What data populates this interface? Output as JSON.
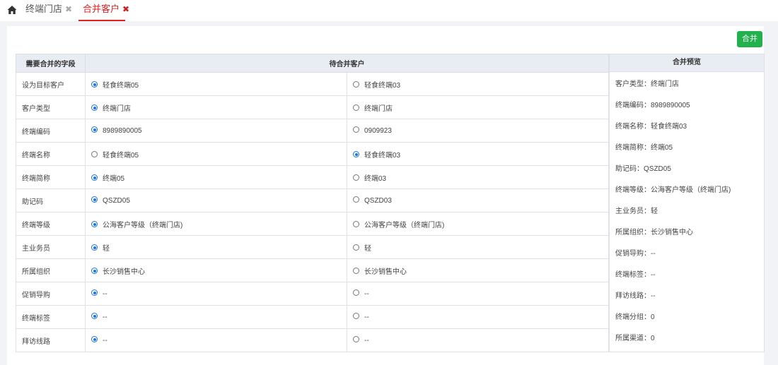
{
  "tabs": [
    {
      "label": "终端门店",
      "close": "✖"
    },
    {
      "label": "合并客户",
      "close": "✖"
    }
  ],
  "toolbar": {
    "merge_label": "合并"
  },
  "table": {
    "headers": [
      "需要合并的字段",
      "待合并客户"
    ],
    "rows": [
      {
        "field": "设为目标客户",
        "a": "轻食终端05",
        "b": "轻食终端03",
        "selected": "a"
      },
      {
        "field": "客户类型",
        "a": "终端门店",
        "b": "终端门店",
        "selected": "a"
      },
      {
        "field": "终端编码",
        "a": "8989890005",
        "b": "0909923",
        "selected": "a"
      },
      {
        "field": "终端名称",
        "a": "轻食终端05",
        "b": "轻食终端03",
        "selected": "b"
      },
      {
        "field": "终端简称",
        "a": "终端05",
        "b": "终端03",
        "selected": "a"
      },
      {
        "field": "助记码",
        "a": "QSZD05",
        "b": "QSZD03",
        "selected": "a"
      },
      {
        "field": "终端等级",
        "a": "公海客户等级（终端门店)",
        "b": "公海客户等级（终端门店)",
        "selected": "a"
      },
      {
        "field": "主业务员",
        "a": "轻",
        "b": "轻",
        "selected": "a"
      },
      {
        "field": "所属组织",
        "a": "长沙销售中心",
        "b": "长沙销售中心",
        "selected": "a"
      },
      {
        "field": "促销导购",
        "a": "--",
        "b": "--",
        "selected": "a"
      },
      {
        "field": "终端标签",
        "a": "--",
        "b": "--",
        "selected": "a"
      },
      {
        "field": "拜访线路",
        "a": "--",
        "b": "--",
        "selected": "a"
      }
    ]
  },
  "preview": {
    "title": "合并预览",
    "items": [
      "客户类型：终端门店",
      "终端编码：8989890005",
      "终端名称：轻食终端03",
      "终端简称：终端05",
      "助记码：QSZD05",
      "终端等级：公海客户等级（终端门店)",
      "主业务员：轻",
      "所属组织：长沙销售中心",
      "促销导购：--",
      "终端标签：--",
      "拜访线路：--",
      "终端分组：0",
      "所属渠道：0"
    ]
  }
}
